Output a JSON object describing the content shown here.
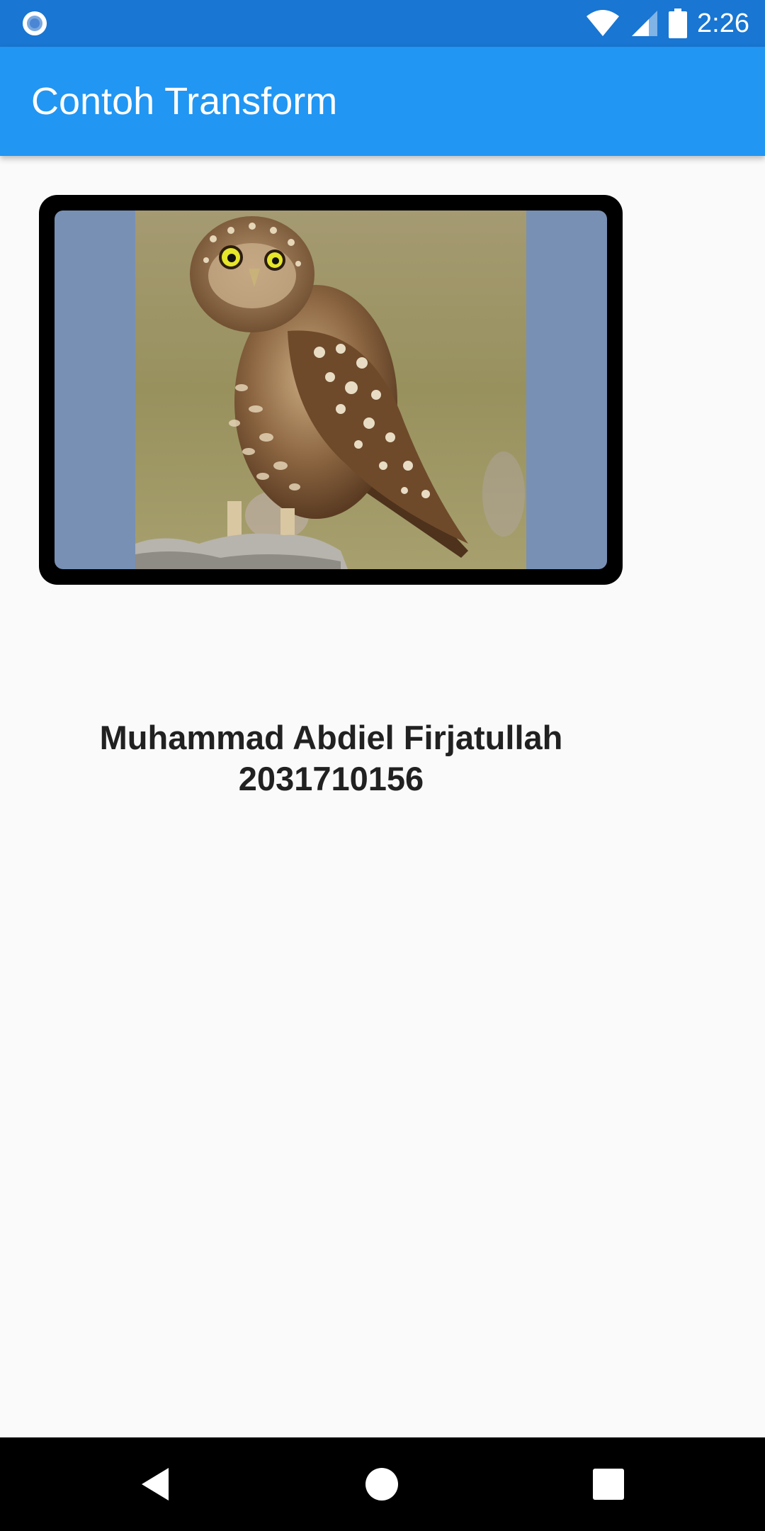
{
  "status_bar": {
    "time": "2:26",
    "left_icon": "circle-notification-icon",
    "right_icons": [
      "wifi-icon",
      "cellular-signal-icon",
      "battery-icon"
    ]
  },
  "app_bar": {
    "title": "Contoh Transform"
  },
  "card": {
    "image": "owl-photo",
    "frame_color": "#000000",
    "inner_background": "#7890b4"
  },
  "info": {
    "name": "Muhammad Abdiel Firjatullah",
    "id": "2031710156"
  },
  "navigation_bar": {
    "buttons": [
      "back-icon",
      "home-icon",
      "recents-icon"
    ]
  },
  "colors": {
    "status_bar": "#1976d2",
    "app_bar": "#2196f3",
    "background": "#fafafa",
    "text": "#212121"
  }
}
